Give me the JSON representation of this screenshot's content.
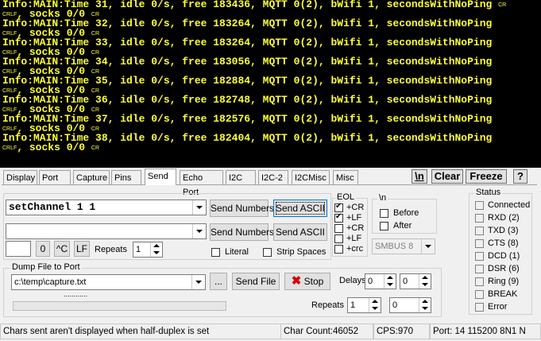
{
  "terminal": {
    "lines": [
      {
        "text": "Info:MAIN:Time 31, idle 0/s, free 183436, MQTT 0(2), bWifi 1, secondsWithNoPing",
        "cr": true
      },
      {
        "text": ", socks 0/0",
        "crlf": true,
        "cr": true
      },
      {
        "text": "Info:MAIN:Time 32, idle 0/s, free 183264, MQTT 0(2), bWifi 1, secondsWithNoPing"
      },
      {
        "text": ", socks 0/0",
        "crlf": true,
        "cr": true
      },
      {
        "text": "Info:MAIN:Time 33, idle 0/s, free 183264, MQTT 0(2), bWifi 1, secondsWithNoPing"
      },
      {
        "text": ", socks 0/0",
        "crlf": true,
        "cr": true
      },
      {
        "text": "Info:MAIN:Time 34, idle 0/s, free 183056, MQTT 0(2), bWifi 1, secondsWithNoPing"
      },
      {
        "text": ", socks 0/0",
        "crlf": true,
        "cr": true
      },
      {
        "text": "Info:MAIN:Time 35, idle 0/s, free 182884, MQTT 0(2), bWifi 1, secondsWithNoPing"
      },
      {
        "text": ", socks 0/0",
        "crlf": true,
        "cr": true
      },
      {
        "text": "Info:MAIN:Time 36, idle 0/s, free 182748, MQTT 0(2), bWifi 1, secondsWithNoPing"
      },
      {
        "text": ", socks 0/0",
        "crlf": true,
        "cr": true
      },
      {
        "text": "Info:MAIN:Time 37, idle 0/s, free 182576, MQTT 0(2), bWifi 1, secondsWithNoPing"
      },
      {
        "text": ", socks 0/0",
        "crlf": true,
        "cr": true
      },
      {
        "text": "Info:MAIN:Time 38, idle 0/s, free 182404, MQTT 0(2), bWifi 1, secondsWithNoPing"
      },
      {
        "text": ", socks 0/0",
        "crlf": true,
        "cr": true
      }
    ],
    "cr_glyph": "CR",
    "crlf_glyph": "CRLF",
    "bg_color": "#000000",
    "text_color": "#ffff3a"
  },
  "tabs": [
    "Display",
    "Port",
    "Capture",
    "Pins",
    "Send",
    "Echo Port",
    "I2C",
    "I2C-2",
    "I2CMisc",
    "Misc"
  ],
  "active_tab": "Send",
  "toolbar": {
    "newline_btn": "\\n",
    "clear_btn": "Clear",
    "freeze_btn": "Freeze",
    "help_btn": "?"
  },
  "send": {
    "command1": "setChannel 1 1",
    "command2": "",
    "send_numbers_label": "Send Numbers",
    "send_ascii_label": "Send ASCII",
    "byte_value": "",
    "zero_btn": "0",
    "ctrl_c_btn": "^C",
    "lf_btn": "LF",
    "repeats_label": "Repeats",
    "repeats_value": "1",
    "literal_label": "Literal",
    "strip_spaces_label": "Strip Spaces"
  },
  "eol": {
    "title": "EOL",
    "options": [
      {
        "label": "+CR",
        "checked": true
      },
      {
        "label": "+LF",
        "checked": true
      },
      {
        "label": "+CR",
        "checked": false
      },
      {
        "label": "+LF",
        "checked": false
      },
      {
        "label": "+crc",
        "checked": false
      }
    ]
  },
  "newline_group": {
    "title": "\\n",
    "before_label": "Before",
    "after_label": "After",
    "smbus_value": "SMBUS 8"
  },
  "dump": {
    "title": "Dump File to Port",
    "path": "c:\\temp\\capture.txt",
    "browse_label": "...",
    "send_file_label": "Send File",
    "stop_label": "Stop",
    "delays_label": "Delays",
    "delay1": "0",
    "delay2": "0",
    "repeats_label": "Repeats",
    "repeats1": "1",
    "repeats2": "0",
    "progress_text": "............"
  },
  "status": {
    "title": "Status",
    "items": [
      "Connected",
      "RXD (2)",
      "TXD (3)",
      "CTS (8)",
      "DCD (1)",
      "DSR (6)",
      "Ring (9)",
      "BREAK",
      "Error"
    ]
  },
  "statusbar": {
    "message": "Chars sent aren't displayed when half-duplex is set",
    "char_count": "Char Count:46052",
    "cps": "CPS:970",
    "port": "Port: 14 115200 8N1 N"
  }
}
